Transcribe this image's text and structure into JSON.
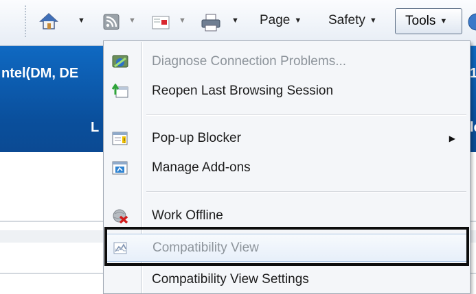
{
  "toolbar": {
    "page_label": "Page",
    "safety_label": "Safety",
    "tools_label": "Tools",
    "dropdown_arrow": "▼"
  },
  "page": {
    "banner_left_text": "ntel(DM, DE",
    "banner_right_text": "1",
    "banner_mid_text": "L",
    "banner_mid_right_text": "le"
  },
  "menu": {
    "items": [
      {
        "label": "Diagnose Connection Problems...",
        "enabled": false,
        "icon": "diagnose-icon"
      },
      {
        "label": "Reopen Last Browsing Session",
        "enabled": true,
        "icon": "reopen-session-icon"
      },
      {
        "label": "Pop-up Blocker",
        "enabled": true,
        "icon": "popup-blocker-icon",
        "submenu": true
      },
      {
        "label": "Manage Add-ons",
        "enabled": true,
        "icon": "addons-icon"
      },
      {
        "label": "Work Offline",
        "enabled": true,
        "icon": "work-offline-icon"
      },
      {
        "label": "Compatibility View",
        "enabled": false,
        "icon": "compatibility-view-icon",
        "highlighted": true
      },
      {
        "label": "Compatibility View Settings",
        "enabled": true
      }
    ],
    "submenu_arrow": "▶"
  }
}
